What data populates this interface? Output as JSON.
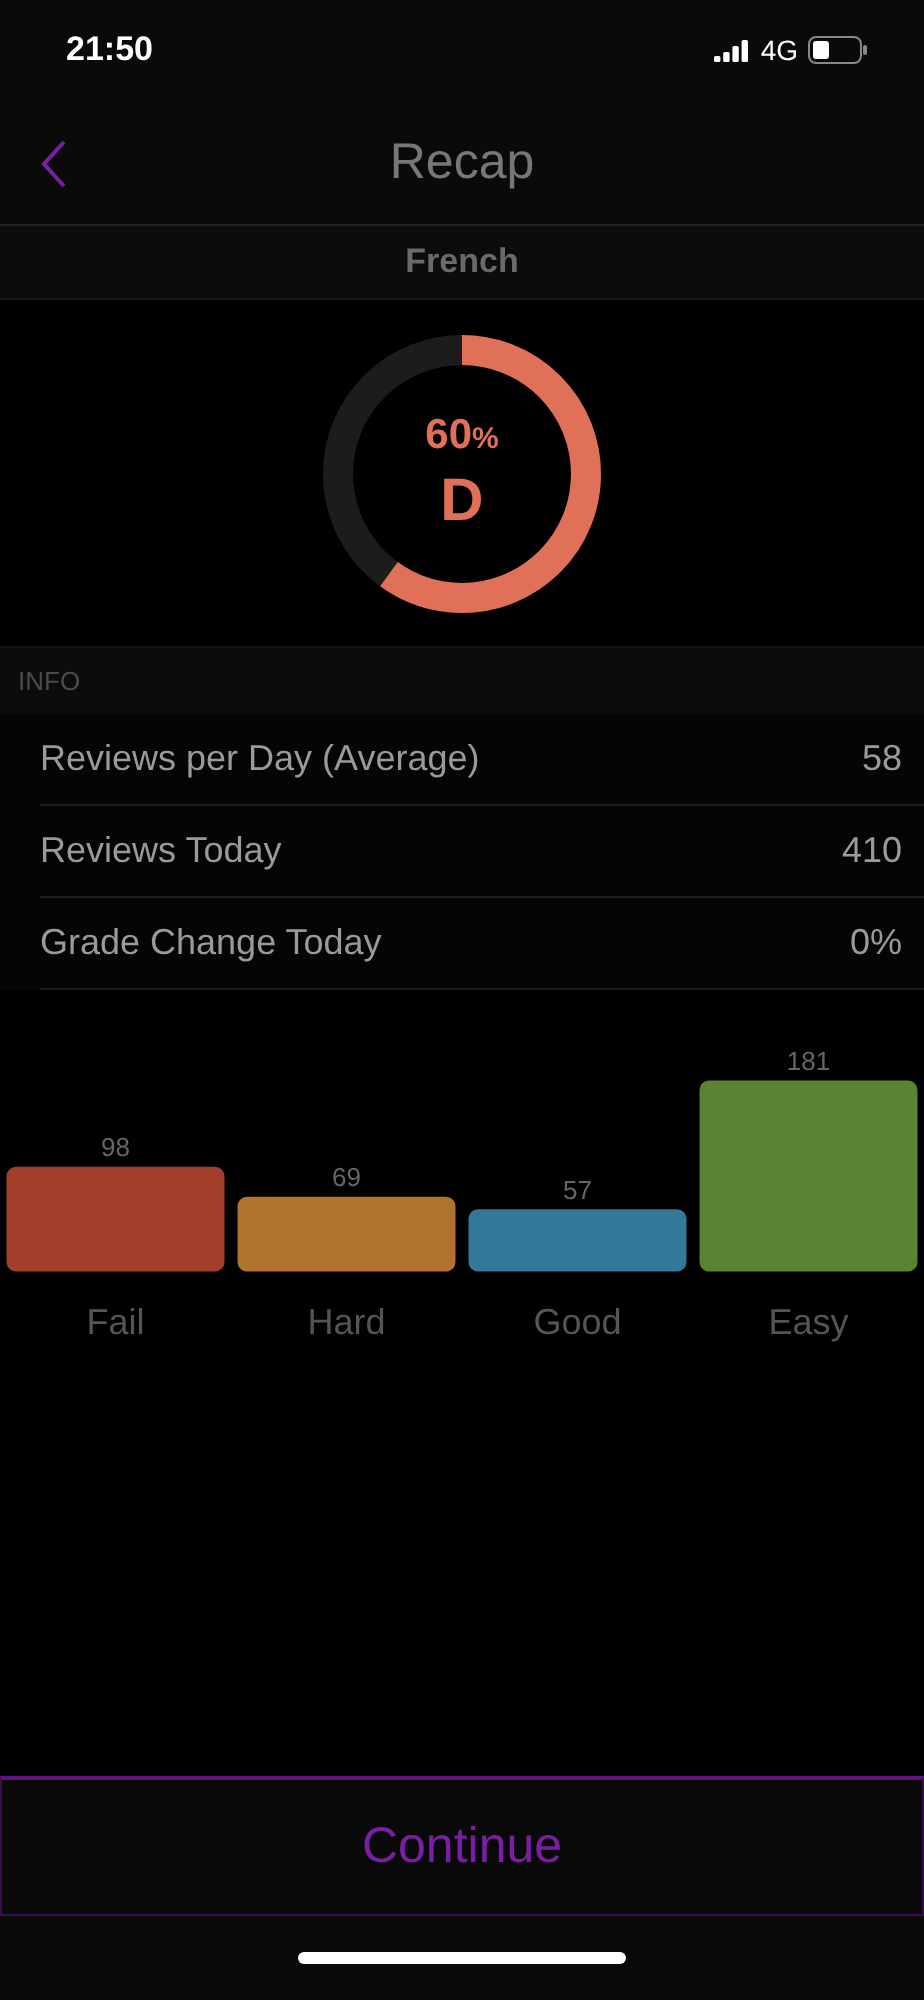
{
  "status_bar": {
    "time": "21:50",
    "network": "4G"
  },
  "nav": {
    "title": "Recap"
  },
  "deck": {
    "name": "French"
  },
  "score": {
    "percent": "60",
    "percent_sign": "%",
    "grade": "D",
    "color": "#e07158"
  },
  "info": {
    "header": "INFO",
    "rows": [
      {
        "label": "Reviews per Day (Average)",
        "value": "58"
      },
      {
        "label": "Reviews Today",
        "value": "410"
      },
      {
        "label": "Grade Change Today",
        "value": "0%"
      }
    ]
  },
  "chart_data": {
    "type": "bar",
    "categories": [
      "Fail",
      "Hard",
      "Good",
      "Easy"
    ],
    "colors": [
      "#933826",
      "#a0692a",
      "#2f6e8c",
      "#52772e"
    ],
    "values": [
      98,
      69,
      57,
      181
    ],
    "data_labels": true
  },
  "continue_button": {
    "label": "Continue"
  }
}
